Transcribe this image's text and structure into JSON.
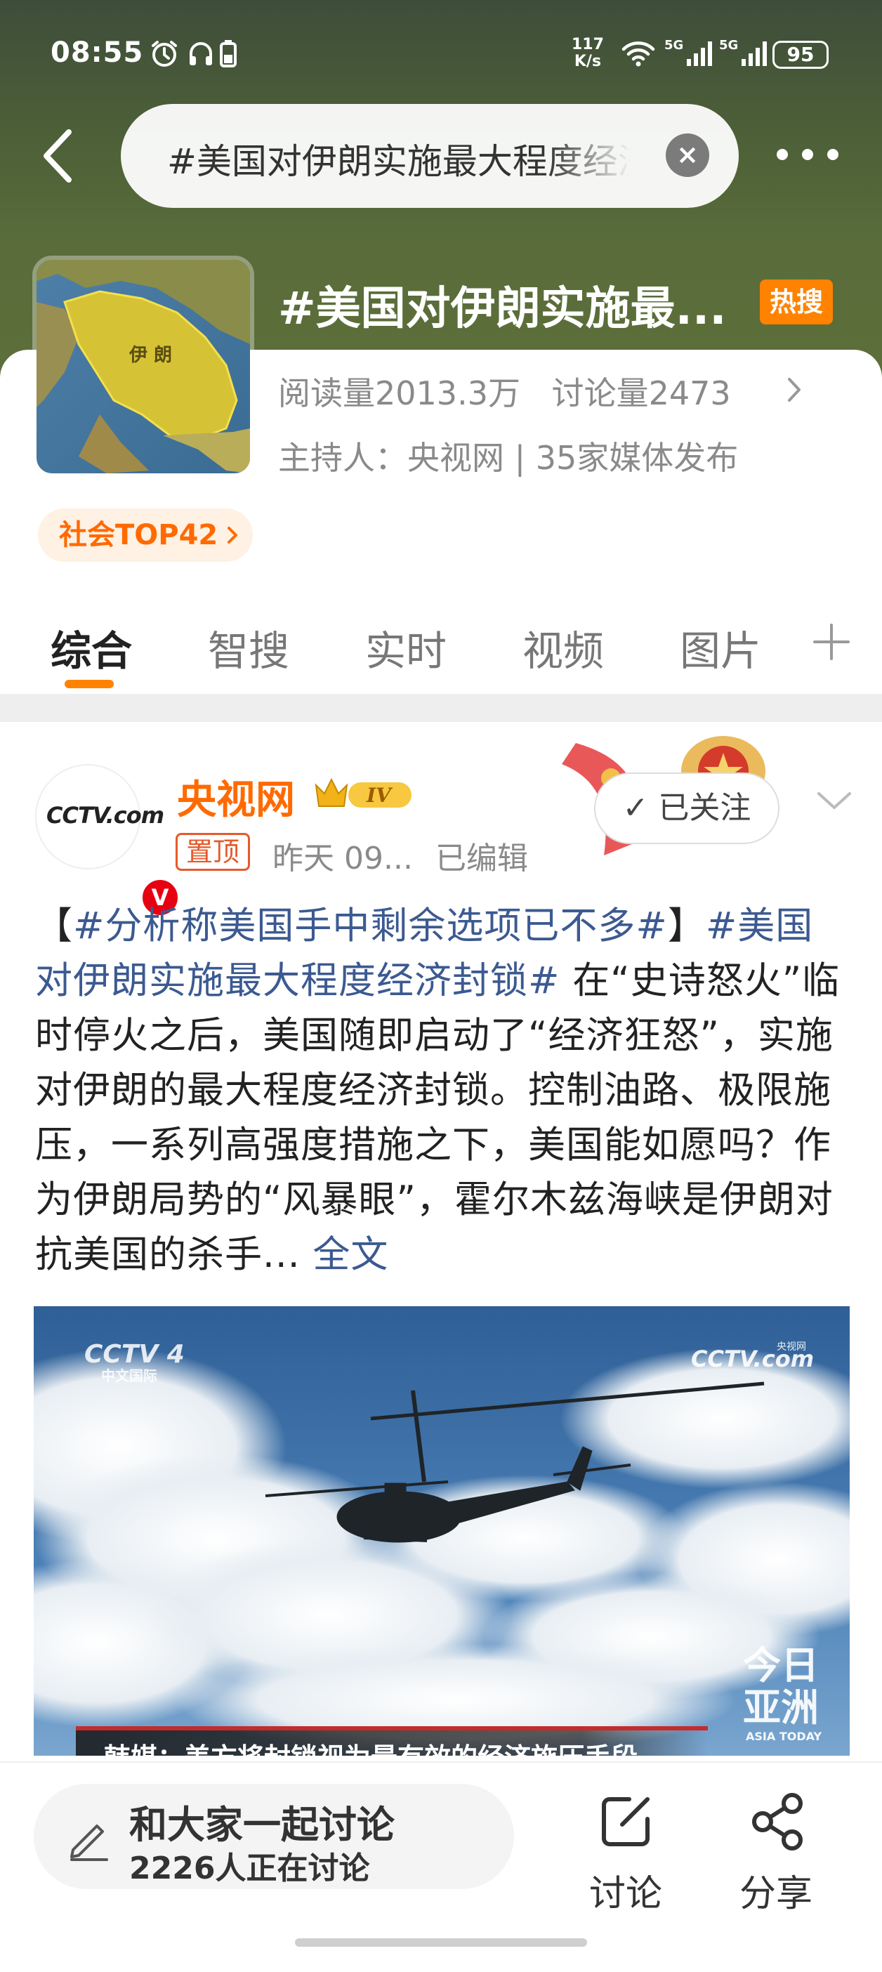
{
  "status_bar": {
    "time": "08:55",
    "net_speed_value": "117",
    "net_speed_unit": "K/s",
    "signal_1_label": "5G",
    "signal_2_label": "5G",
    "battery": "95",
    "icons": [
      "alarm-icon",
      "headphones-icon",
      "battery-saver-icon",
      "wifi-icon",
      "signal-icon",
      "battery-icon"
    ]
  },
  "search": {
    "query": "#美国对伊朗实施最大程度经济封锁#"
  },
  "topic": {
    "title": "#美国对伊朗实施最...",
    "hot_badge": "热搜",
    "thumb_label": "伊 朗",
    "reads": "阅读量2013.3万",
    "discussions": "讨论量2473",
    "host": "主持人：央视网 | 35家媒体发布",
    "rank_tag": "社会TOP42"
  },
  "tabs": [
    {
      "label": "综合",
      "active": true
    },
    {
      "label": "智搜",
      "active": false
    },
    {
      "label": "实时",
      "active": false
    },
    {
      "label": "视频",
      "active": false
    },
    {
      "label": "图片",
      "active": false
    }
  ],
  "post": {
    "avatar_text": "CCTV.com",
    "verified_badge": "V",
    "author": "央视网",
    "member_level": "IV",
    "pinned": "置顶",
    "time": "昨天 09...",
    "edited": "已编辑",
    "follow_label": "已关注",
    "body": {
      "bracket_open": "【",
      "tag1": "#分析称美国手中剩余选项已不多#",
      "bracket_close": "】",
      "tag2": "#美国对伊朗实施最大程度经济封锁#",
      "text": " 在“史诗怒火”临时停火之后，美国随即启动了“经济狂怒”，实施对伊朗的最大程度经济封锁。控制油路、极限施压，一系列高强度措施之下，美国能如愿吗？作为伊朗局势的“风暴眼”，霍尔木兹海峡是伊朗对抗美国的杀手...",
      "more": " 全文"
    },
    "video": {
      "watermark_left": "CCTV 4",
      "watermark_left_sub": "中文国际",
      "watermark_right": "CCTV.com",
      "watermark_right_sub": "央视网",
      "program_logo_1": "今日",
      "program_logo_2": "亚洲",
      "program_logo_sub": "ASIA TODAY",
      "caption": "韩媒：美方将封锁视为最有效的经济施压手段"
    }
  },
  "bottom_bar": {
    "discuss_label": "和大家一起讨论",
    "discuss_count": "2226人正在讨论",
    "comment_label": "讨论",
    "share_label": "分享"
  },
  "colors": {
    "accent_orange": "#ff8200",
    "author_orange": "#ff6a00",
    "link_blue": "#3c5a91",
    "verified_red": "#e60012"
  }
}
